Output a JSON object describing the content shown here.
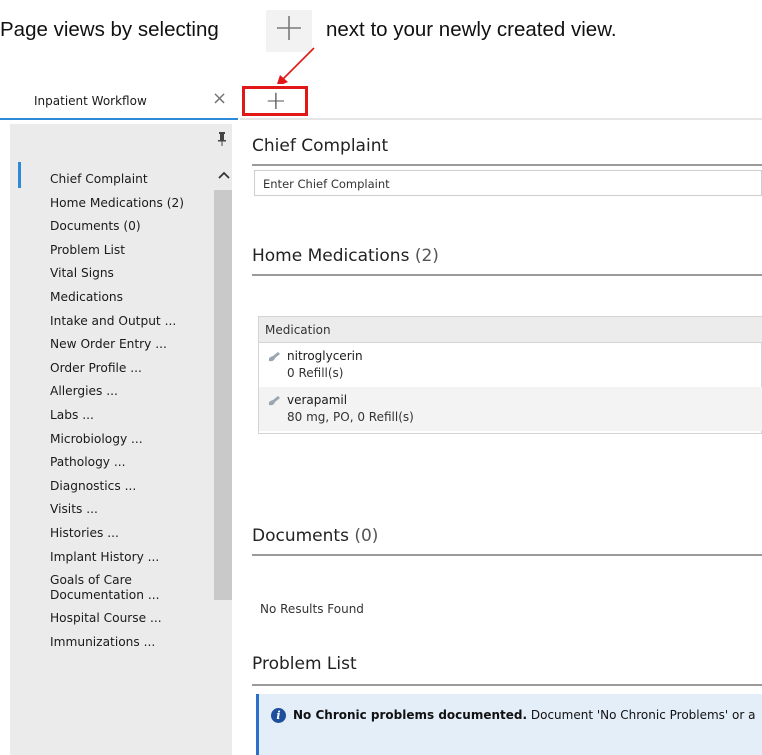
{
  "instruction": {
    "before": "Page views by selecting",
    "after": "next to your newly created view."
  },
  "tab": {
    "label": "Inpatient Workflow",
    "close_glyph": "×",
    "add_glyph": "+"
  },
  "sidebar": {
    "pin_glyph": "⯐",
    "scroll_up_glyph": "^",
    "items": [
      {
        "label": "Chief Complaint"
      },
      {
        "label": "Home Medications (2)"
      },
      {
        "label": "Documents (0)"
      },
      {
        "label": "Problem List"
      },
      {
        "label": "Vital Signs"
      },
      {
        "label": "Medications"
      },
      {
        "label": "Intake and Output ..."
      },
      {
        "label": "New Order Entry ..."
      },
      {
        "label": "Order Profile ..."
      },
      {
        "label": "Allergies ..."
      },
      {
        "label": "Labs ..."
      },
      {
        "label": "Microbiology ..."
      },
      {
        "label": "Pathology ..."
      },
      {
        "label": "Diagnostics ..."
      },
      {
        "label": "Visits ..."
      },
      {
        "label": "Histories ..."
      },
      {
        "label": "Implant History ..."
      },
      {
        "label": "Goals of Care Documentation ..."
      },
      {
        "label": "Hospital Course ..."
      },
      {
        "label": "Immunizations ..."
      }
    ]
  },
  "chief_complaint": {
    "title": "Chief Complaint",
    "placeholder": "Enter Chief Complaint"
  },
  "home_medications": {
    "title": "Home Medications",
    "count": "(2)",
    "column_header": "Medication",
    "rows": [
      {
        "name": "nitroglycerin",
        "detail": "0 Refill(s)"
      },
      {
        "name": "verapamil",
        "detail": "80 mg, PO, 0 Refill(s)"
      }
    ]
  },
  "documents": {
    "title": "Documents",
    "count": "(0)",
    "empty_text": "No Results Found"
  },
  "problem_list": {
    "title": "Problem List",
    "info_bold": "No Chronic problems documented.",
    "info_rest": " Document 'No Chronic Problems' or a"
  },
  "colors": {
    "accent": "#2d8ad8",
    "highlight_box": "#e01818",
    "info_bg": "#e4eef9",
    "sidebar_bg": "#ebebeb"
  },
  "icons": {
    "tab_close": "close-icon",
    "add_view": "plus-icon",
    "pin": "pin-icon",
    "scroll_up": "chevron-up-icon",
    "medication": "pill-icon",
    "info": "info-icon"
  }
}
